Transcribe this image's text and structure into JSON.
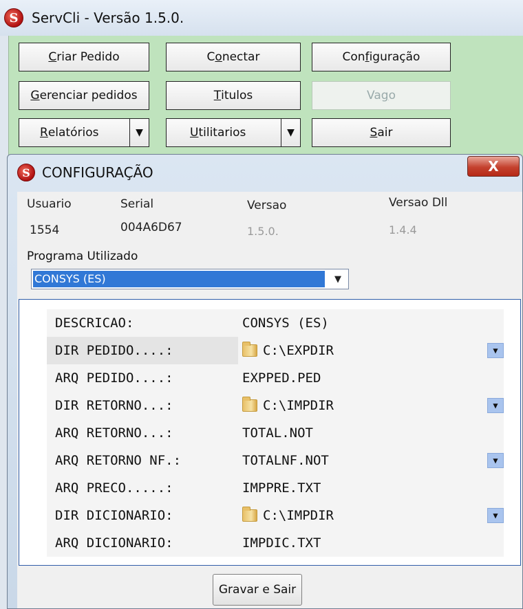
{
  "main_window": {
    "title": "ServCli - Versão 1.5.0.",
    "logo_icon": "servcli-logo-icon",
    "buttons": {
      "criar_pedido": {
        "pre": "",
        "ul": "C",
        "post": "riar Pedido"
      },
      "conectar": {
        "pre": "C",
        "ul": "o",
        "post": "nectar"
      },
      "configuracao": {
        "pre": "Con",
        "ul": "f",
        "post": "iguração"
      },
      "gerenciar_pedidos": {
        "pre": "",
        "ul": "G",
        "post": "erenciar pedidos"
      },
      "titulos": {
        "pre": "",
        "ul": "T",
        "post": "itulos"
      },
      "vago": {
        "pre": "Va",
        "ul": "g",
        "post": "o"
      },
      "relatorios": {
        "pre": "",
        "ul": "R",
        "post": "elatórios"
      },
      "utilitarios": {
        "pre": "",
        "ul": "U",
        "post": "tilitarios"
      },
      "sair": {
        "pre": "",
        "ul": "S",
        "post": "air"
      }
    },
    "panel_color": "#bfe3bd"
  },
  "dialog": {
    "title": "CONFIGURAÇÃO",
    "close_label": "X",
    "info": {
      "usuario_label": "Usuario",
      "usuario_value": "1554",
      "serial_label": "Serial",
      "serial_value": "004A6D67",
      "versao_label": "Versao",
      "versao_value": "1.5.0.",
      "versao_dll_label": "Versao Dll",
      "versao_dll_value": "1.4.4"
    },
    "program_label": "Programa Utilizado",
    "program_selected": "CONSYS (ES)",
    "config_rows": [
      {
        "key": "DESCRICAO:",
        "value": "CONSYS (ES)",
        "folder": false,
        "dropdown": false
      },
      {
        "key": "DIR PEDIDO....:",
        "value": "C:\\EXPDIR",
        "folder": true,
        "dropdown": true
      },
      {
        "key": "ARQ PEDIDO....:",
        "value": "EXPPED.PED",
        "folder": false,
        "dropdown": false
      },
      {
        "key": "DIR RETORNO...:",
        "value": "C:\\IMPDIR",
        "folder": true,
        "dropdown": true
      },
      {
        "key": "ARQ RETORNO...:",
        "value": "TOTAL.NOT",
        "folder": false,
        "dropdown": false
      },
      {
        "key": "ARQ RETORNO NF.:",
        "value": "TOTALNF.NOT",
        "folder": false,
        "dropdown": true
      },
      {
        "key": "ARQ PRECO.....:",
        "value": "IMPPRE.TXT",
        "folder": false,
        "dropdown": false
      },
      {
        "key": "DIR DICIONARIO:",
        "value": "C:\\IMPDIR",
        "folder": true,
        "dropdown": true
      },
      {
        "key": "ARQ DICIONARIO:",
        "value": "IMPDIC.TXT",
        "folder": false,
        "dropdown": false
      }
    ],
    "save_label": "Gravar e Sair"
  }
}
